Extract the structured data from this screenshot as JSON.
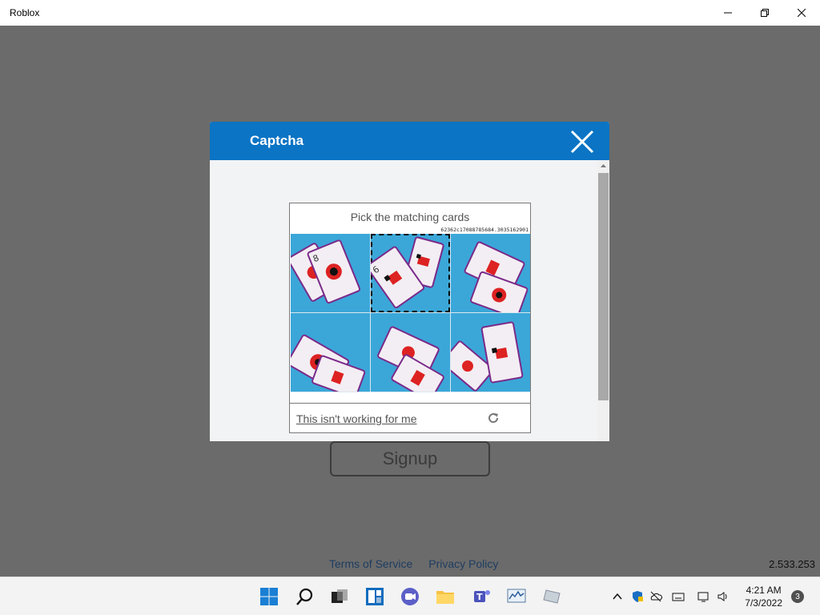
{
  "window": {
    "title": "Roblox"
  },
  "app": {
    "signup_label": "Signup",
    "terms_label": "Terms of Service",
    "privacy_label": "Privacy Policy",
    "version": "2.533.253"
  },
  "captcha": {
    "title": "Captcha",
    "prompt": "Pick the matching cards",
    "session_id": "62362c17088785684.3035162901",
    "not_working_label": "This isn't working for me",
    "header_color": "#0b74c4",
    "selected_cell": 1
  },
  "taskbar": {
    "time": "4:21 AM",
    "date": "7/3/2022",
    "notification_count": "3",
    "icons": [
      "windows-start-icon",
      "search-icon",
      "task-view-icon",
      "widgets-icon",
      "chat-icon",
      "file-explorer-icon",
      "teams-icon",
      "performance-monitor-icon",
      "roblox-app-icon"
    ]
  }
}
